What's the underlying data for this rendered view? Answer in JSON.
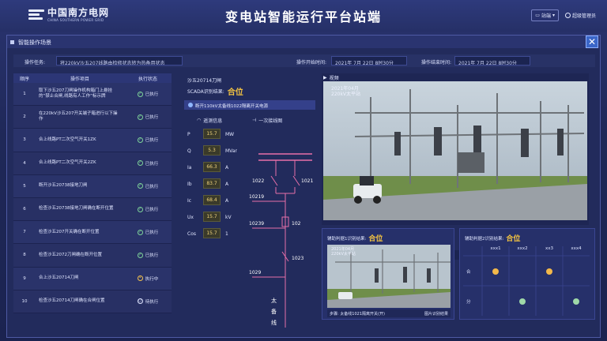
{
  "header": {
    "logo_cn": "中国南方电网",
    "logo_en": "CHINA SOUTHERN POWER GRID",
    "title": "变电站智能运行平台站端",
    "station_label": "站端",
    "user_label": "超级管理员"
  },
  "panel": {
    "title": "智能操作场景",
    "close_label": "✕",
    "task_label": "操作任务:",
    "task_value": "将220kV沙五207线路由检修状态转为热备用状态",
    "start_label": "操作开始时间:",
    "start_value": "2021年 7月 22日 8时30分",
    "end_label": "操作结束时间:",
    "end_value": "2021年 7月 22日 8时30分"
  },
  "steps": {
    "headers": [
      "顺序",
      "操作项目",
      "执行状态"
    ],
    "rows": [
      {
        "no": "1",
        "item": "取下沙五207刀闸操作机构箱门上悬挂的“禁止合闸,线路有人工作”标示牌",
        "status": "已执行",
        "state": "done"
      },
      {
        "no": "2",
        "item": "在220kV沙五207开关端子箱进行以下操作",
        "status": "已执行",
        "state": "done"
      },
      {
        "no": "3",
        "item": "合上线路PT二次空气开关1ZK",
        "status": "已执行",
        "state": "done"
      },
      {
        "no": "4",
        "item": "合上线路PT二次空气开关2ZK",
        "status": "已执行",
        "state": "done"
      },
      {
        "no": "5",
        "item": "断开沙五20738接地刀闸",
        "status": "已执行",
        "state": "done"
      },
      {
        "no": "6",
        "item": "检查沙五20738接地刀闸确在断开位置",
        "status": "已执行",
        "state": "done"
      },
      {
        "no": "7",
        "item": "检查沙五207开关确在断开位置",
        "status": "已执行",
        "state": "done"
      },
      {
        "no": "8",
        "item": "检查沙五2072刀闸确在断开位置",
        "status": "已执行",
        "state": "done"
      },
      {
        "no": "9",
        "item": "合上沙五20714刀闸",
        "status": "执行中",
        "state": "run"
      },
      {
        "no": "10",
        "item": "检查沙五20714刀闸确在合闸位置",
        "status": "待执行",
        "state": "wait"
      }
    ]
  },
  "mid": {
    "device": "沙五20714刀闸",
    "scada_label": "SCADA识别结果:",
    "scada_result": "合位",
    "op_text": "断开110kV太备线1022隔离开关电源",
    "telemetry_label": "遥测信息",
    "diagram_label": "一次接线图",
    "measurements": [
      {
        "name": "P",
        "value": "15.7",
        "unit": "MW"
      },
      {
        "name": "Q",
        "value": "5.3",
        "unit": "MVar"
      },
      {
        "name": "Ia",
        "value": "66.3",
        "unit": "A"
      },
      {
        "name": "Ib",
        "value": "83.7",
        "unit": "A"
      },
      {
        "name": "Ic",
        "value": "68.4",
        "unit": "A"
      },
      {
        "name": "Ux",
        "value": "15.7",
        "unit": "kV"
      },
      {
        "name": "Cos",
        "value": "15.7",
        "unit": "1"
      }
    ],
    "diagram_labels": [
      "1022",
      "1021",
      "10219",
      "102",
      "10239",
      "1023",
      "1029",
      "太",
      "备",
      "线"
    ]
  },
  "video": {
    "label": "视频",
    "osd_line1": "2021年04月",
    "osd_line2": "220kV太平站"
  },
  "aux1": {
    "label": "辅助判据1识别结果:",
    "result": "合位",
    "osd_line1": "2021年04月",
    "osd_line2": "220kV太平站",
    "caption_left": "步骤: 太备线1021隔离开关(开)",
    "caption_right": "图片识别结果"
  },
  "aux2": {
    "label": "辅助判据2识别结果:",
    "result": "合位",
    "cols": [
      "xxx1",
      "xxx2",
      "xx3",
      "xxx4"
    ],
    "rows": [
      "合",
      "分"
    ],
    "colors": {
      "on": "#f3b84a",
      "off": "#9fd8a8"
    }
  },
  "colors": {
    "accent": "#f3c341",
    "done": "#7ed39a"
  }
}
